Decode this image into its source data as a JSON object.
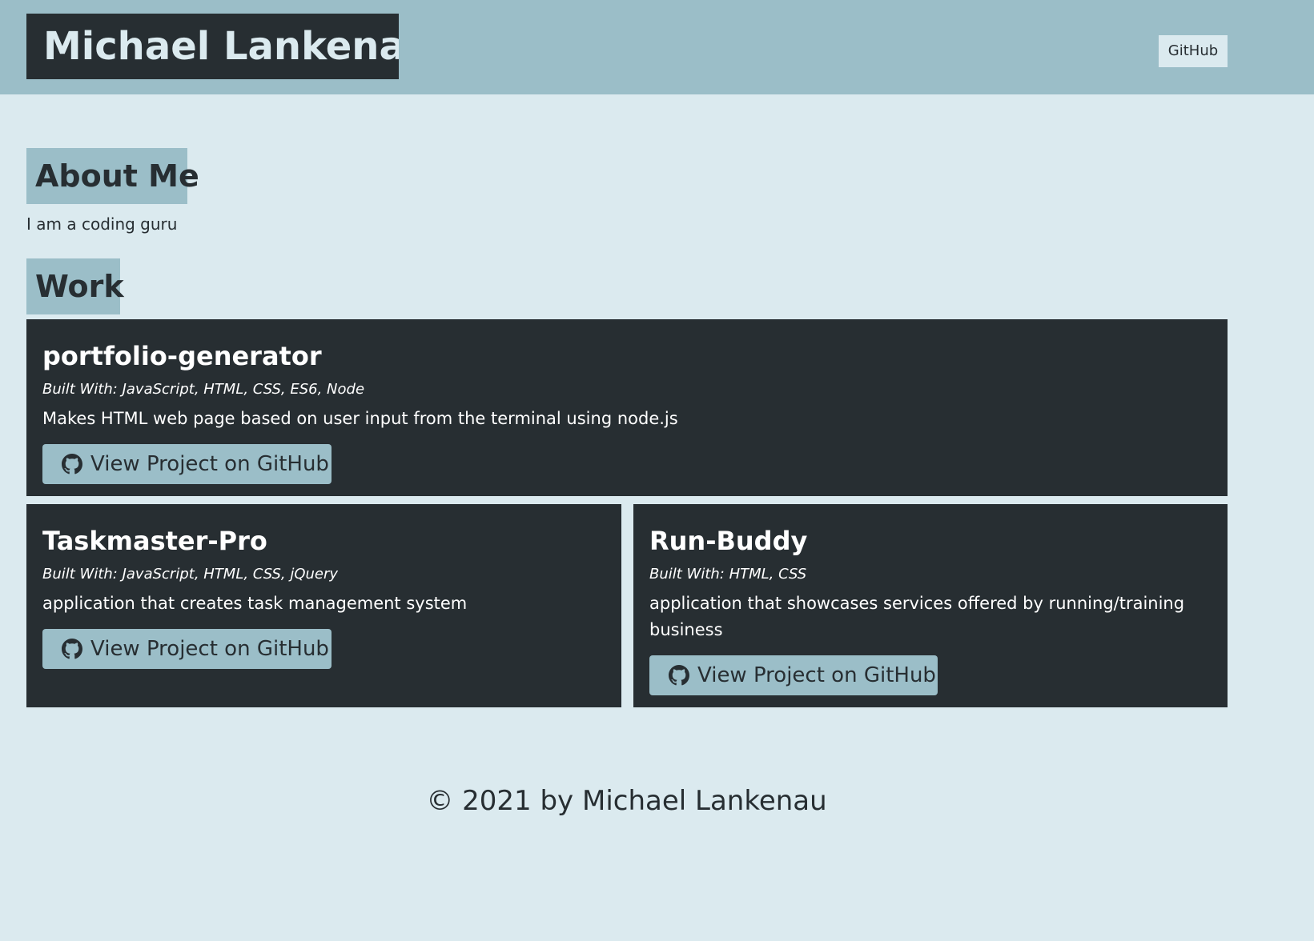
{
  "header": {
    "title": "Michael Lankenau",
    "nav_github_label": "GitHub"
  },
  "about": {
    "heading": "About Me",
    "text": "I am a coding guru"
  },
  "work": {
    "heading": "Work",
    "projects": [
      {
        "title": "portfolio-generator",
        "built_with": "Built With: JavaScript, HTML, CSS, ES6, Node",
        "description": "Makes HTML web page based on user input from the terminal using node.js",
        "button_label": "View Project on GitHub",
        "button_icon": "github-icon"
      },
      {
        "title": "Taskmaster-Pro",
        "built_with": "Built With: JavaScript, HTML, CSS, jQuery",
        "description": "application that creates task management system",
        "button_label": "View Project on GitHub",
        "button_icon": "github-icon"
      },
      {
        "title": "Run-Buddy",
        "built_with": "Built With: HTML, CSS",
        "description": "application that showcases services offered by running/training business",
        "button_label": "View Project on GitHub",
        "button_icon": "github-icon"
      }
    ]
  },
  "footer": {
    "text": "© 2021 by Michael Lankenau"
  },
  "colors": {
    "page_bg": "#dbeaef",
    "header_bg": "#9bbec8",
    "dark": "#272e32",
    "accent": "#9bbec8"
  }
}
